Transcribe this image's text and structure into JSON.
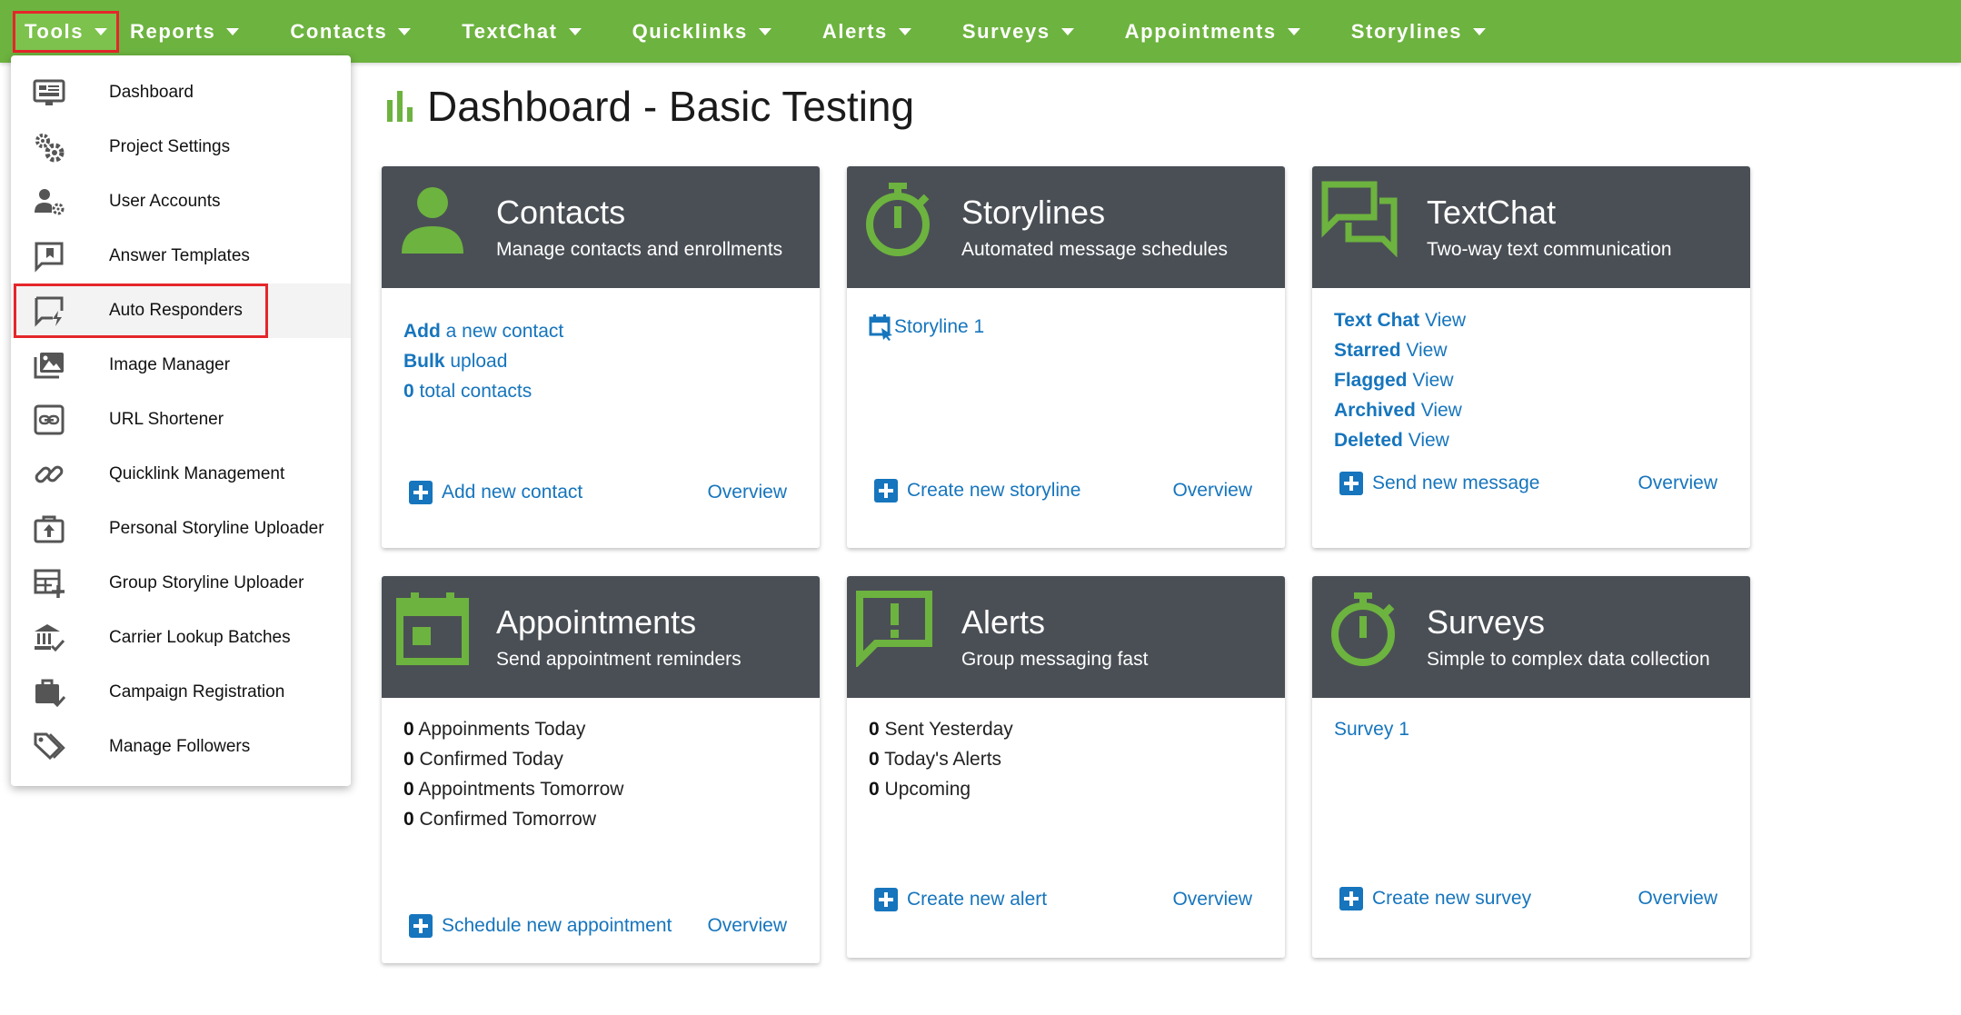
{
  "nav": {
    "items": [
      "Tools",
      "Reports",
      "Contacts",
      "TextChat",
      "Quicklinks",
      "Alerts",
      "Surveys",
      "Appointments",
      "Storylines"
    ]
  },
  "tools_menu": {
    "items": [
      {
        "label": "Dashboard",
        "icon": "dashboard-icon"
      },
      {
        "label": "Project Settings",
        "icon": "gears-icon"
      },
      {
        "label": "User Accounts",
        "icon": "user-gear-icon"
      },
      {
        "label": "Answer Templates",
        "icon": "chat-bookmark-icon"
      },
      {
        "label": "Auto Responders",
        "icon": "chat-bolt-icon"
      },
      {
        "label": "Image Manager",
        "icon": "images-icon"
      },
      {
        "label": "URL Shortener",
        "icon": "link-box-icon"
      },
      {
        "label": "Quicklink Management",
        "icon": "link-icon"
      },
      {
        "label": "Personal Storyline Uploader",
        "icon": "briefcase-upload-icon"
      },
      {
        "label": "Group Storyline Uploader",
        "icon": "table-plus-icon"
      },
      {
        "label": "Carrier Lookup Batches",
        "icon": "bank-check-icon"
      },
      {
        "label": "Campaign Registration",
        "icon": "briefcase-check-icon"
      },
      {
        "label": "Manage Followers",
        "icon": "tags-icon"
      }
    ]
  },
  "page": {
    "title": "Dashboard - Basic Testing"
  },
  "cards": {
    "contacts": {
      "title": "Contacts",
      "subtitle": "Manage contacts and enrollments",
      "l1b": "Add",
      "l1": " a new contact",
      "l2b": "Bulk",
      "l2": " upload",
      "l3b": "0",
      "l3": " total contacts",
      "action": "Add new contact",
      "overview": "Overview"
    },
    "storylines": {
      "title": "Storylines",
      "subtitle": "Automated message schedules",
      "item1": "Storyline 1",
      "action": "Create new storyline",
      "overview": "Overview"
    },
    "textchat": {
      "title": "TextChat",
      "subtitle": "Two-way text communication",
      "rows": [
        {
          "b": "Text Chat",
          "t": " View"
        },
        {
          "b": "Starred",
          "t": " View"
        },
        {
          "b": "Flagged",
          "t": " View"
        },
        {
          "b": "Archived",
          "t": " View"
        },
        {
          "b": "Deleted",
          "t": " View"
        }
      ],
      "action": "Send new message",
      "overview": "Overview"
    },
    "appointments": {
      "title": "Appointments",
      "subtitle": "Send appointment reminders",
      "rows": [
        {
          "b": "0",
          "t": " Appoinments Today"
        },
        {
          "b": "0",
          "t": " Confirmed Today"
        },
        {
          "b": "0",
          "t": " Appointments Tomorrow"
        },
        {
          "b": "0",
          "t": " Confirmed Tomorrow"
        }
      ],
      "action": "Schedule new appointment",
      "overview": "Overview"
    },
    "alerts": {
      "title": "Alerts",
      "subtitle": "Group messaging fast",
      "rows": [
        {
          "b": "0",
          "t": " Sent Yesterday"
        },
        {
          "b": "0",
          "t": " Today's Alerts"
        },
        {
          "b": "0",
          "t": " Upcoming"
        }
      ],
      "action": "Create new alert",
      "overview": "Overview"
    },
    "surveys": {
      "title": "Surveys",
      "subtitle": "Simple to complex data collection",
      "item1": "Survey 1",
      "action": "Create new survey",
      "overview": "Overview"
    }
  },
  "colors": {
    "nav_green": "#6db33f",
    "icon_green": "#6db33f",
    "card_header": "#4a4f55",
    "link_blue": "#1675bd",
    "highlight_red": "#e5262a"
  }
}
